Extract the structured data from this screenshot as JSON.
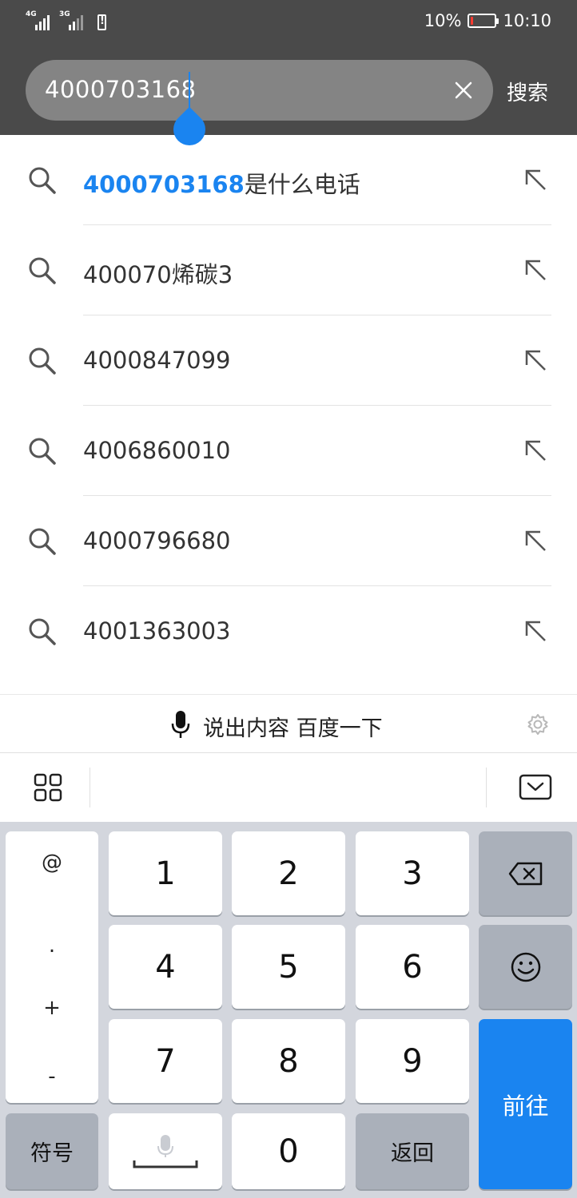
{
  "status_bar": {
    "signal1_type": "4G",
    "signal2_type": "3G",
    "battery_percent": "10%",
    "battery_level": 0.1,
    "time": "10:10"
  },
  "search": {
    "value": "4000703168",
    "clear_icon": "close-icon",
    "submit_label": "搜索"
  },
  "suggestions": [
    {
      "highlight": "4000703168",
      "rest": "是什么电话"
    },
    {
      "highlight": "",
      "rest": "400070烯碳3"
    },
    {
      "highlight": "",
      "rest": "4000847099"
    },
    {
      "highlight": "",
      "rest": "4006860010"
    },
    {
      "highlight": "",
      "rest": "4000796680"
    },
    {
      "highlight": "",
      "rest": "4001363003"
    }
  ],
  "voice": {
    "label": "说出内容 百度一下"
  },
  "keyboard": {
    "symbols": [
      "@",
      ".",
      "+",
      "-"
    ],
    "digits": [
      "1",
      "2",
      "3",
      "4",
      "5",
      "6",
      "7",
      "8",
      "9",
      "0"
    ],
    "symbol_key": "符号",
    "back_key": "返回",
    "go_key": "前往"
  },
  "colors": {
    "accent": "#1a84f0",
    "header_bg": "#4a4a4a",
    "keyboard_bg": "#d3d6dd",
    "battery_low": "#ff3b30"
  }
}
